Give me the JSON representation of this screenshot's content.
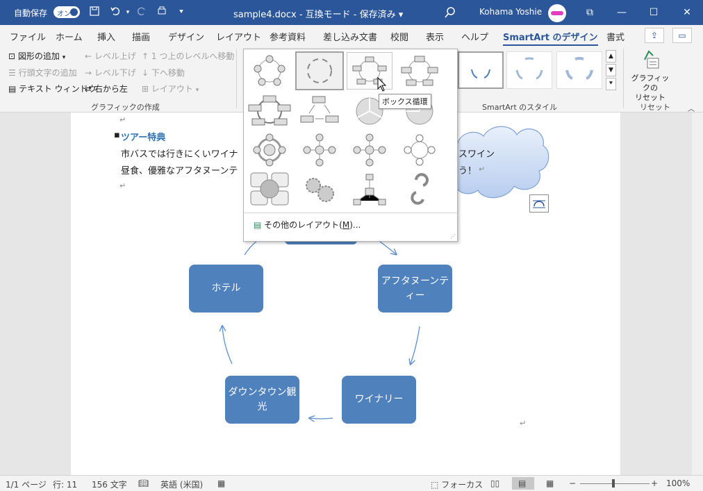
{
  "titlebar": {
    "autosave_label": "自動保存",
    "autosave_state": "オン",
    "title": "sample4.docx  -  互換モード  -  保存済み  ▾",
    "user_name": "Kohama Yoshie",
    "win_restore": "⧉",
    "win_min": "—",
    "win_max": "☐",
    "win_close": "✕"
  },
  "tabs": [
    {
      "label": "ファイル"
    },
    {
      "label": "ホーム"
    },
    {
      "label": "挿入"
    },
    {
      "label": "描画"
    },
    {
      "label": "デザイン"
    },
    {
      "label": "レイアウト"
    },
    {
      "label": "参考資料"
    },
    {
      "label": "差し込み文書"
    },
    {
      "label": "校閲"
    },
    {
      "label": "表示"
    },
    {
      "label": "ヘルプ"
    },
    {
      "label": "SmartArt のデザイン"
    },
    {
      "label": "書式"
    }
  ],
  "ribbon": {
    "create_graphic": {
      "add_shape": "図形の追加",
      "add_bullet": "行頭文字の追加",
      "text_pane": "テキスト ウィンドウ",
      "promote": "レベル上げ",
      "demote": "レベル下げ",
      "right_to_left": "右から左",
      "move_up": "1 つ上のレベルへ移動",
      "move_down": "下へ移動",
      "layout": "レイアウト",
      "group_label": "グラフィックの作成"
    },
    "styles_label": "SmartArt のスタイル",
    "reset_button_line1": "グラフィックの",
    "reset_button_line2": "リセット",
    "reset_label": "リセット"
  },
  "document": {
    "mark_top": "↵",
    "heading": "ツアー特典",
    "line1_start": "市バスでは行きにくいワイナ",
    "line1_end": "スワイン",
    "line2_start": "昼食、優雅なアフタヌーンテ",
    "line2_end": "う！",
    "mark_empty": "↵",
    "mark_bottom": "↵",
    "nodes": {
      "hotel": "ホテル",
      "afternoon_tea": "アフタヌーンティー",
      "winery": "ワイナリー",
      "downtown": "ダウンタウン観光"
    }
  },
  "gallery": {
    "tooltip": "ボックス循環",
    "more_layouts_prefix": "その他のレイアウト(",
    "more_layouts_key": "M",
    "more_layouts_suffix": ")...",
    "rows": 4,
    "cols": 4
  },
  "status": {
    "page": "1/1 ページ",
    "line": "行: 11",
    "chars": "156 文字",
    "lang": "英語 (米国)",
    "focus": "フォーカス",
    "zoom_minus": "−",
    "zoom_plus": "+",
    "zoom": "100%",
    "zoom_level": 1.0
  },
  "colors": {
    "titlebar": "#2b579a",
    "node_fill": "#4f81bd",
    "arrow": "#5b8fd0",
    "heading": "#2e74b5"
  }
}
